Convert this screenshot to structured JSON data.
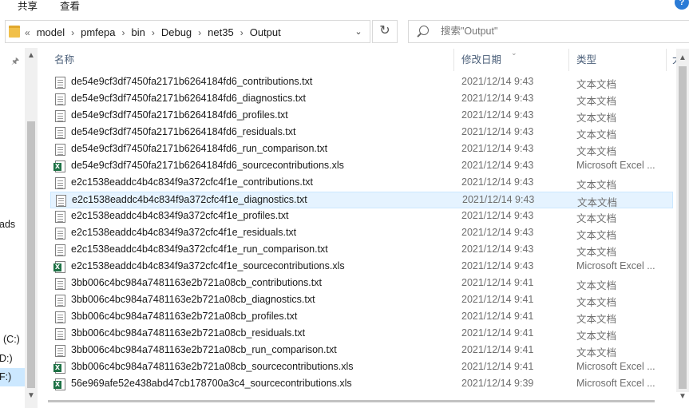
{
  "ribbon": {
    "tabs": [
      "共享",
      "查看"
    ]
  },
  "address": {
    "lead": "«",
    "crumbs": [
      "model",
      "pmfepa",
      "bin",
      "Debug",
      "net35",
      "Output"
    ]
  },
  "search": {
    "placeholder": "搜索\"Output\""
  },
  "nav": {
    "items": [
      "ads",
      "(C:)",
      "D:)",
      "F:)"
    ]
  },
  "columns": {
    "name": "名称",
    "date": "修改日期",
    "type": "类型",
    "size": "大"
  },
  "files": [
    {
      "name": "de54e9cf3df7450fa2171b6264184fd6_contributions.txt",
      "date": "2021/12/14 9:43",
      "type": "文本文档",
      "icon": "txt"
    },
    {
      "name": "de54e9cf3df7450fa2171b6264184fd6_diagnostics.txt",
      "date": "2021/12/14 9:43",
      "type": "文本文档",
      "icon": "txt"
    },
    {
      "name": "de54e9cf3df7450fa2171b6264184fd6_profiles.txt",
      "date": "2021/12/14 9:43",
      "type": "文本文档",
      "icon": "txt"
    },
    {
      "name": "de54e9cf3df7450fa2171b6264184fd6_residuals.txt",
      "date": "2021/12/14 9:43",
      "type": "文本文档",
      "icon": "txt"
    },
    {
      "name": "de54e9cf3df7450fa2171b6264184fd6_run_comparison.txt",
      "date": "2021/12/14 9:43",
      "type": "文本文档",
      "icon": "txt"
    },
    {
      "name": "de54e9cf3df7450fa2171b6264184fd6_sourcecontributions.xls",
      "date": "2021/12/14 9:43",
      "type": "Microsoft Excel ...",
      "icon": "xls"
    },
    {
      "name": "e2c1538eaddc4b4c834f9a372cfc4f1e_contributions.txt",
      "date": "2021/12/14 9:43",
      "type": "文本文档",
      "icon": "txt"
    },
    {
      "name": "e2c1538eaddc4b4c834f9a372cfc4f1e_diagnostics.txt",
      "date": "2021/12/14 9:43",
      "type": "文本文档",
      "icon": "txt",
      "selected": true
    },
    {
      "name": "e2c1538eaddc4b4c834f9a372cfc4f1e_profiles.txt",
      "date": "2021/12/14 9:43",
      "type": "文本文档",
      "icon": "txt"
    },
    {
      "name": "e2c1538eaddc4b4c834f9a372cfc4f1e_residuals.txt",
      "date": "2021/12/14 9:43",
      "type": "文本文档",
      "icon": "txt"
    },
    {
      "name": "e2c1538eaddc4b4c834f9a372cfc4f1e_run_comparison.txt",
      "date": "2021/12/14 9:43",
      "type": "文本文档",
      "icon": "txt"
    },
    {
      "name": "e2c1538eaddc4b4c834f9a372cfc4f1e_sourcecontributions.xls",
      "date": "2021/12/14 9:43",
      "type": "Microsoft Excel ...",
      "icon": "xls"
    },
    {
      "name": "3bb006c4bc984a7481163e2b721a08cb_contributions.txt",
      "date": "2021/12/14 9:41",
      "type": "文本文档",
      "icon": "txt"
    },
    {
      "name": "3bb006c4bc984a7481163e2b721a08cb_diagnostics.txt",
      "date": "2021/12/14 9:41",
      "type": "文本文档",
      "icon": "txt"
    },
    {
      "name": "3bb006c4bc984a7481163e2b721a08cb_profiles.txt",
      "date": "2021/12/14 9:41",
      "type": "文本文档",
      "icon": "txt"
    },
    {
      "name": "3bb006c4bc984a7481163e2b721a08cb_residuals.txt",
      "date": "2021/12/14 9:41",
      "type": "文本文档",
      "icon": "txt"
    },
    {
      "name": "3bb006c4bc984a7481163e2b721a08cb_run_comparison.txt",
      "date": "2021/12/14 9:41",
      "type": "文本文档",
      "icon": "txt"
    },
    {
      "name": "3bb006c4bc984a7481163e2b721a08cb_sourcecontributions.xls",
      "date": "2021/12/14 9:41",
      "type": "Microsoft Excel ...",
      "icon": "xls"
    },
    {
      "name": "56e969afe52e438abd47cb178700a3c4_sourcecontributions.xls",
      "date": "2021/12/14 9:39",
      "type": "Microsoft Excel ...",
      "icon": "xls"
    }
  ]
}
